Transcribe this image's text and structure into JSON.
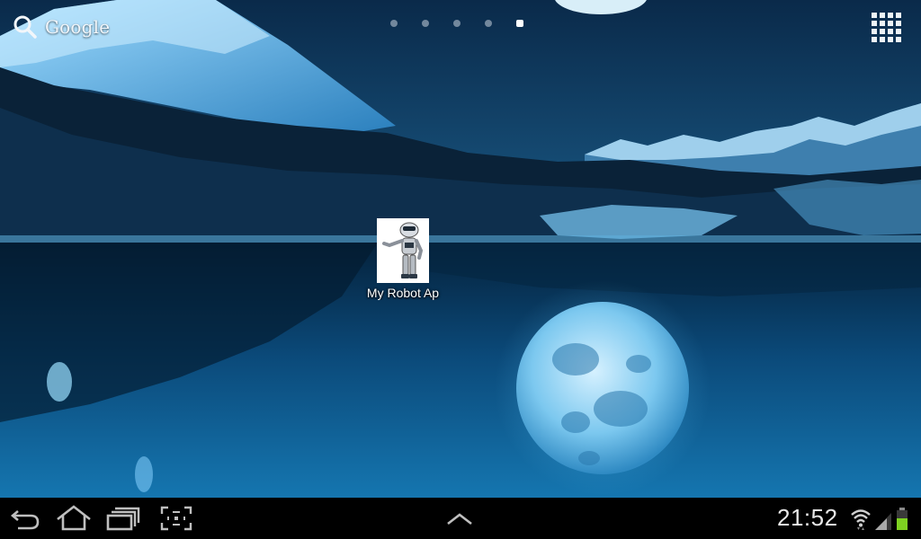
{
  "search_widget": {
    "label": "Google",
    "icon": "search-icon"
  },
  "home_pages": {
    "count": 5,
    "active_index": 4
  },
  "all_apps": {
    "icon": "grid-icon"
  },
  "shortcut": {
    "label": "My Robot Ap",
    "icon": "robot-icon"
  },
  "system_bar": {
    "back_icon": "back-icon",
    "home_icon": "home-icon",
    "recents_icon": "recent-apps-icon",
    "screenshot_icon": "screenshot-icon",
    "menu_icon": "chevron-up-icon",
    "clock": "21:52",
    "wifi_icon": "wifi-icon",
    "signal_icon": "signal-icon",
    "battery_icon": "battery-icon",
    "battery_color": "#7ed321"
  },
  "colors": {
    "accent": "#33b5e5",
    "status_bar_bg": "#000000"
  }
}
